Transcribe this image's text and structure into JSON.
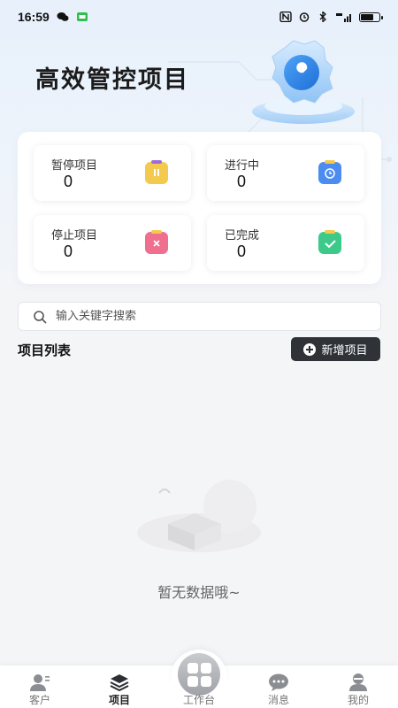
{
  "status_bar": {
    "time": "16:59"
  },
  "page_title": "高效管控项目",
  "stats": [
    {
      "label": "暂停项目",
      "value": "0",
      "icon": "pause-icon",
      "color": "#f3c94e"
    },
    {
      "label": "进行中",
      "value": "0",
      "icon": "clock-icon",
      "color": "#4c8cf0"
    },
    {
      "label": "停止项目",
      "value": "0",
      "icon": "stop-icon",
      "color": "#ef6f8f"
    },
    {
      "label": "已完成",
      "value": "0",
      "icon": "check-icon",
      "color": "#3cc98a"
    }
  ],
  "search": {
    "placeholder": "输入关键字搜索"
  },
  "list": {
    "title": "项目列表",
    "add_label": "新增项目"
  },
  "empty": {
    "text": "暂无数据哦~"
  },
  "tabs": [
    {
      "label": "客户",
      "icon": "customer-icon"
    },
    {
      "label": "项目",
      "icon": "project-layers-icon"
    },
    {
      "label": "工作台",
      "icon": "workbench-grid-icon"
    },
    {
      "label": "消息",
      "icon": "message-icon"
    },
    {
      "label": "我的",
      "icon": "profile-icon"
    }
  ],
  "active_tab": "项目"
}
